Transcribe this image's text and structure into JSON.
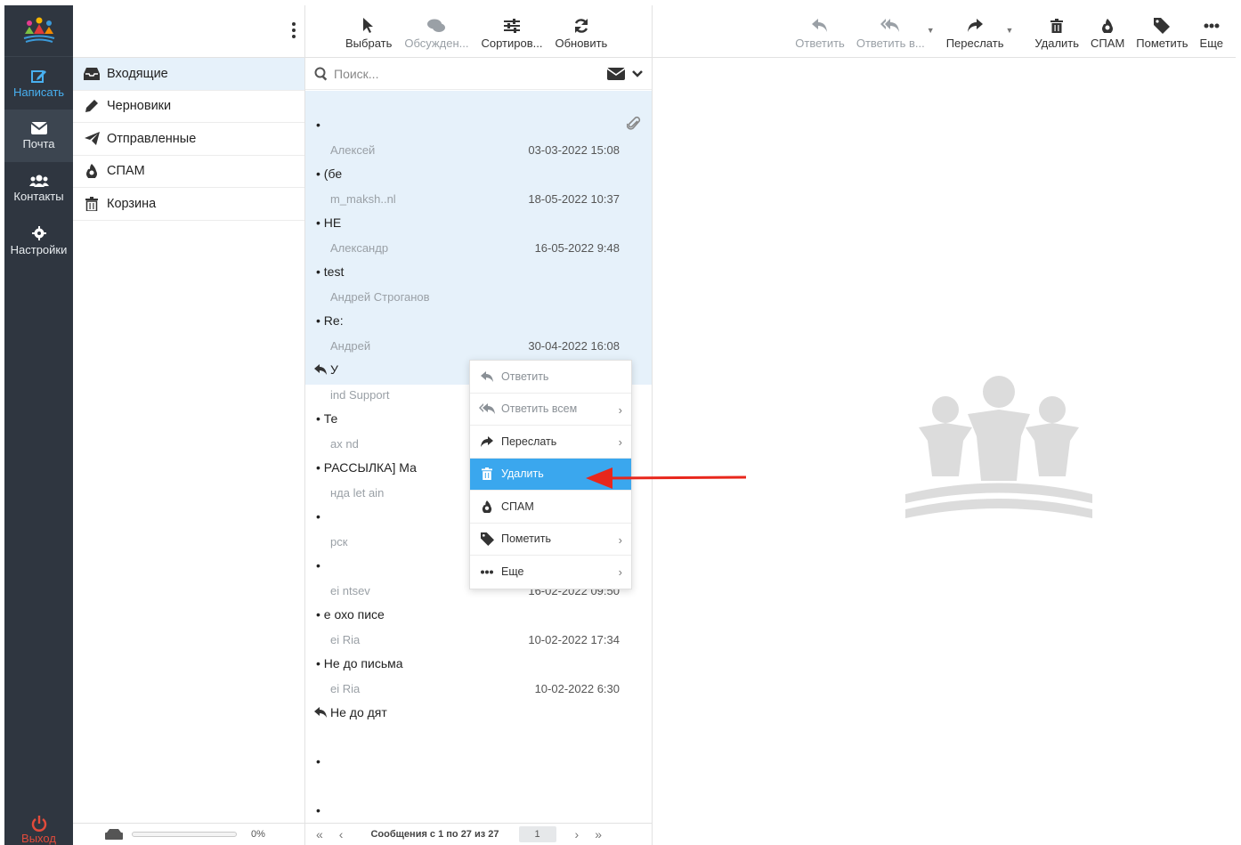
{
  "nav": {
    "compose": "Написать",
    "mail": "Почта",
    "contacts": "Контакты",
    "settings": "Настройки",
    "logout": "Выход"
  },
  "folders": [
    {
      "label": "Входящие",
      "icon": "inbox-icon"
    },
    {
      "label": "Черновики",
      "icon": "pencil-icon"
    },
    {
      "label": "Отправленные",
      "icon": "paper-plane-icon"
    },
    {
      "label": "СПАМ",
      "icon": "fire-icon"
    },
    {
      "label": "Корзина",
      "icon": "trash-icon"
    }
  ],
  "quota": {
    "percent": "0%"
  },
  "list_toolbar": {
    "select": "Выбрать",
    "threads": "Обсужден...",
    "sort": "Сортиров...",
    "refresh": "Обновить"
  },
  "search": {
    "placeholder": "Поиск..."
  },
  "messages": [
    {
      "from": "",
      "date": "",
      "subject": "•",
      "selected": true
    },
    {
      "from": "Алексей",
      "date": "03-03-2022 15:08",
      "subject": "• (бе",
      "selected": true
    },
    {
      "from": "m_maksh..nl",
      "date": "18-05-2022 10:37",
      "subject": "• HE",
      "selected": true
    },
    {
      "from": "Александр",
      "date": "16-05-2022 9:48",
      "subject": "• test",
      "selected": true
    },
    {
      "from": "Андрей Строганов",
      "date": "",
      "subject": "• Re:",
      "selected": true
    },
    {
      "from": "Андрей",
      "date": "30-04-2022 16:08",
      "subject": "У",
      "selected": true,
      "replied": true
    },
    {
      "from": "ind Support",
      "date": "",
      "subject": "• Те",
      "selected": false
    },
    {
      "from": "ax nd",
      "date": "",
      "subject": "• РАССЫЛКА] Ма",
      "selected": false
    },
    {
      "from": "ндa let ain",
      "date": "",
      "subject": "•",
      "selected": false
    },
    {
      "from": "рск",
      "date": "",
      "subject": "•",
      "selected": false
    },
    {
      "from": "ei ntsev",
      "date": "16-02-2022 09:50",
      "subject": "• е охо писе",
      "selected": false
    },
    {
      "from": "ei Ria",
      "date": "10-02-2022 17:34",
      "subject": "• Не до письма",
      "selected": false
    },
    {
      "from": "ei Ria",
      "date": "10-02-2022 6:30",
      "subject": "Не до дят",
      "selected": false,
      "replied": true
    },
    {
      "from": "",
      "date": "",
      "subject": "•",
      "selected": false
    },
    {
      "from": "",
      "date": "",
      "subject": "•",
      "selected": false
    }
  ],
  "pagination": {
    "summary": "Сообщения с 1 по 27 из 27",
    "page": "1"
  },
  "reader_toolbar": {
    "reply": "Ответить",
    "reply_all": "Ответить в...",
    "forward": "Переслать",
    "delete": "Удалить",
    "spam": "СПАМ",
    "flag": "Пометить",
    "more": "Еще"
  },
  "context_menu": [
    {
      "label": "Ответить",
      "icon": "reply-icon",
      "dim": true,
      "submenu": false
    },
    {
      "label": "Ответить всем",
      "icon": "reply-all-icon",
      "dim": true,
      "submenu": true
    },
    {
      "label": "Переслать",
      "icon": "forward-icon",
      "dim": false,
      "submenu": true
    },
    {
      "label": "Удалить",
      "icon": "trash-icon",
      "dim": false,
      "submenu": false,
      "highlight": true
    },
    {
      "label": "СПАМ",
      "icon": "fire-icon",
      "dim": false,
      "submenu": false
    },
    {
      "label": "Пометить",
      "icon": "tag-icon",
      "dim": false,
      "submenu": true
    },
    {
      "label": "Еще",
      "icon": "ellipsis-icon",
      "dim": false,
      "submenu": true
    }
  ],
  "colors": {
    "nav_bg": "#2f3640",
    "accent": "#3aa7ee",
    "logout": "#e24b3b",
    "arrow": "#e8271c"
  }
}
